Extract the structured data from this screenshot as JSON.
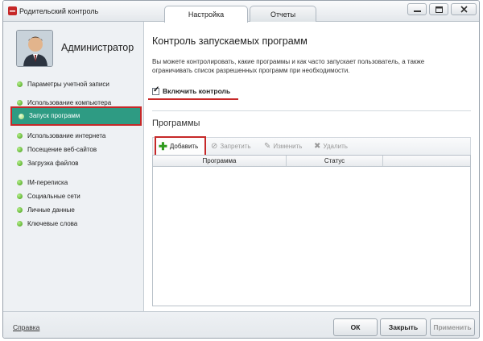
{
  "window": {
    "title": "Родительский контроль"
  },
  "tabs": [
    {
      "label": "Настройка",
      "active": true
    },
    {
      "label": "Отчеты",
      "active": false
    }
  ],
  "user": {
    "name": "Администратор"
  },
  "sidebar": {
    "items": [
      {
        "label": "Параметры учетной записи"
      },
      {
        "label": "Использование компьютера"
      },
      {
        "label": "Запуск программ",
        "active": true
      },
      {
        "label": "Использование интернета"
      },
      {
        "label": "Посещение веб-сайтов"
      },
      {
        "label": "Загрузка файлов"
      },
      {
        "label": "IM-переписка"
      },
      {
        "label": "Социальные сети"
      },
      {
        "label": "Личные данные"
      },
      {
        "label": "Ключевые слова"
      }
    ]
  },
  "main": {
    "title": "Контроль запускаемых программ",
    "description": "Вы можете контролировать, какие программы и как часто запускает пользователь, а также ограничивать список разрешенных программ при необходимости.",
    "enable_checkbox": {
      "label": "Включить контроль",
      "checked": true
    },
    "programs_title": "Программы",
    "toolbar": {
      "add": "Добавить",
      "deny": "Запретить",
      "edit": "Изменить",
      "delete": "Удалить"
    },
    "table": {
      "columns": [
        "Программа",
        "Статус",
        ""
      ],
      "rows": []
    }
  },
  "footer": {
    "help": "Справка",
    "ok": "ОК",
    "close": "Закрыть",
    "apply": "Применить"
  },
  "colors": {
    "accent": "#2e9b83",
    "highlight": "#c62828",
    "dot": "#3f9b12"
  },
  "icons": {
    "add": "plus-icon",
    "deny": "block-icon",
    "edit": "pencil-icon",
    "delete": "x-icon"
  }
}
